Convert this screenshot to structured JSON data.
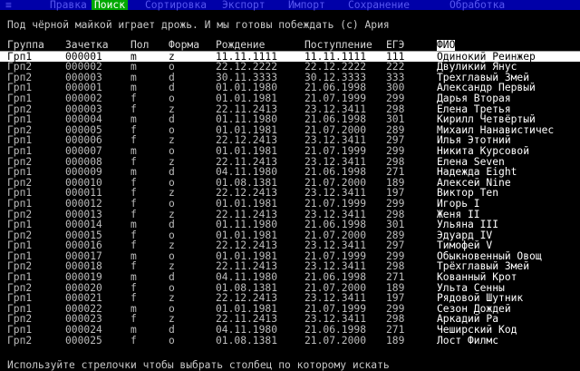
{
  "menu": {
    "system_icon": "≡",
    "items": [
      "Правка",
      "Поиск",
      "Сортировка",
      "Экспорт",
      "Импорт",
      "Сохранение",
      "Обработка"
    ],
    "active_index": 1
  },
  "banner": "Под чёрной майкой играет дрожь. И мы готовы побеждать (c) Ария",
  "table": {
    "headers": [
      "Группа",
      "Зачетка",
      "Пол",
      "Форма",
      "Рождение",
      "Поступление",
      "ЕГЭ",
      "ФИО"
    ],
    "selected_header_index": 7,
    "selected_row_index": 0,
    "rows": [
      [
        "Грп1",
        "000001",
        "m",
        "z",
        "11.11.1111",
        "11.11.1111",
        "111",
        "Одинокий Реинжер"
      ],
      [
        "Грп2",
        "000002",
        "m",
        "o",
        "22.12.2222",
        "22.12.2222",
        "222",
        "Двуликий Янус"
      ],
      [
        "Грп2",
        "000003",
        "m",
        "d",
        "30.11.3333",
        "30.12.3333",
        "333",
        "Трехглавый Змей"
      ],
      [
        "Грп1",
        "000001",
        "m",
        "d",
        "01.01.1980",
        "21.06.1998",
        "300",
        "Александр Первый"
      ],
      [
        "Грп1",
        "000002",
        "f",
        "o",
        "01.01.1981",
        "21.07.1999",
        "299",
        "Дарья Вторая"
      ],
      [
        "Грп2",
        "000003",
        "f",
        "z",
        "22.11.2413",
        "23.12.3411",
        "298",
        "Елена Третья"
      ],
      [
        "Грп1",
        "000004",
        "m",
        "d",
        "01.11.1980",
        "21.06.1998",
        "301",
        "Кирилл Четвёртый"
      ],
      [
        "Грп2",
        "000005",
        "f",
        "o",
        "01.01.1981",
        "21.07.2000",
        "289",
        "Михаил Нанавистичес"
      ],
      [
        "Грп1",
        "000006",
        "f",
        "z",
        "22.12.2413",
        "23.12.3411",
        "297",
        "Илья Этотний"
      ],
      [
        "Грп1",
        "000007",
        "m",
        "o",
        "01.01.1981",
        "21.07.1999",
        "299",
        "Никита Курсовой"
      ],
      [
        "Грп2",
        "000008",
        "f",
        "z",
        "22.11.2413",
        "23.12.3411",
        "298",
        "Елена Seven"
      ],
      [
        "Грп1",
        "000009",
        "m",
        "d",
        "04.11.1980",
        "21.06.1998",
        "271",
        "Надежда Eight"
      ],
      [
        "Грп2",
        "000010",
        "f",
        "o",
        "01.08.1381",
        "21.07.2000",
        "189",
        "Алексей Nine"
      ],
      [
        "Грп1",
        "000011",
        "f",
        "z",
        "22.12.2413",
        "23.12.3411",
        "197",
        "Виктор Ten"
      ],
      [
        "Грп1",
        "000012",
        "f",
        "o",
        "01.01.1981",
        "21.07.1999",
        "299",
        "Игорь I"
      ],
      [
        "Грп2",
        "000013",
        "f",
        "z",
        "22.11.2413",
        "23.12.3411",
        "298",
        "Женя II"
      ],
      [
        "Грп1",
        "000014",
        "m",
        "d",
        "01.11.1980",
        "21.06.1998",
        "301",
        "Ульяна III"
      ],
      [
        "Грп2",
        "000015",
        "f",
        "o",
        "01.01.1981",
        "21.07.2000",
        "289",
        "Эдуард IV"
      ],
      [
        "Грп1",
        "000016",
        "f",
        "z",
        "22.12.2413",
        "23.12.3411",
        "297",
        "Тимофей V"
      ],
      [
        "Грп1",
        "000017",
        "m",
        "o",
        "01.01.1981",
        "21.07.1999",
        "299",
        "Обыкновенный Овощ"
      ],
      [
        "Грп2",
        "000018",
        "f",
        "z",
        "22.11.2413",
        "23.12.3411",
        "298",
        "Трёхглавый Змей"
      ],
      [
        "Грп1",
        "000019",
        "m",
        "d",
        "04.11.1980",
        "21.06.1998",
        "271",
        "Кованный Крот"
      ],
      [
        "Грп2",
        "000020",
        "f",
        "o",
        "01.08.1381",
        "21.07.2000",
        "189",
        "Ульта Сенны"
      ],
      [
        "Грп1",
        "000021",
        "f",
        "z",
        "22.12.2413",
        "23.12.3411",
        "197",
        "Рядовой Шутник"
      ],
      [
        "Грп1",
        "000022",
        "m",
        "o",
        "01.01.1981",
        "21.07.1999",
        "299",
        "Сезон Дождей"
      ],
      [
        "Грп2",
        "000023",
        "f",
        "z",
        "22.11.2413",
        "23.12.3411",
        "298",
        "Аркадий Ра"
      ],
      [
        "Грп1",
        "000024",
        "m",
        "d",
        "04.11.1980",
        "21.06.1998",
        "271",
        "Чеширский Код"
      ],
      [
        "Грп2",
        "000025",
        "f",
        "o",
        "01.08.1381",
        "21.07.2000",
        "189",
        "Лост Филмс"
      ]
    ]
  },
  "status": "Используйте стрелочки чтобы выбрать столбец по которому искать",
  "colors": {
    "menu_bg": "#0000a8",
    "menu_text": "#5656f0",
    "menu_active_bg": "#00a800",
    "background": "#000000",
    "text": "#bcbcbc",
    "highlight_bg": "#ffffff"
  }
}
